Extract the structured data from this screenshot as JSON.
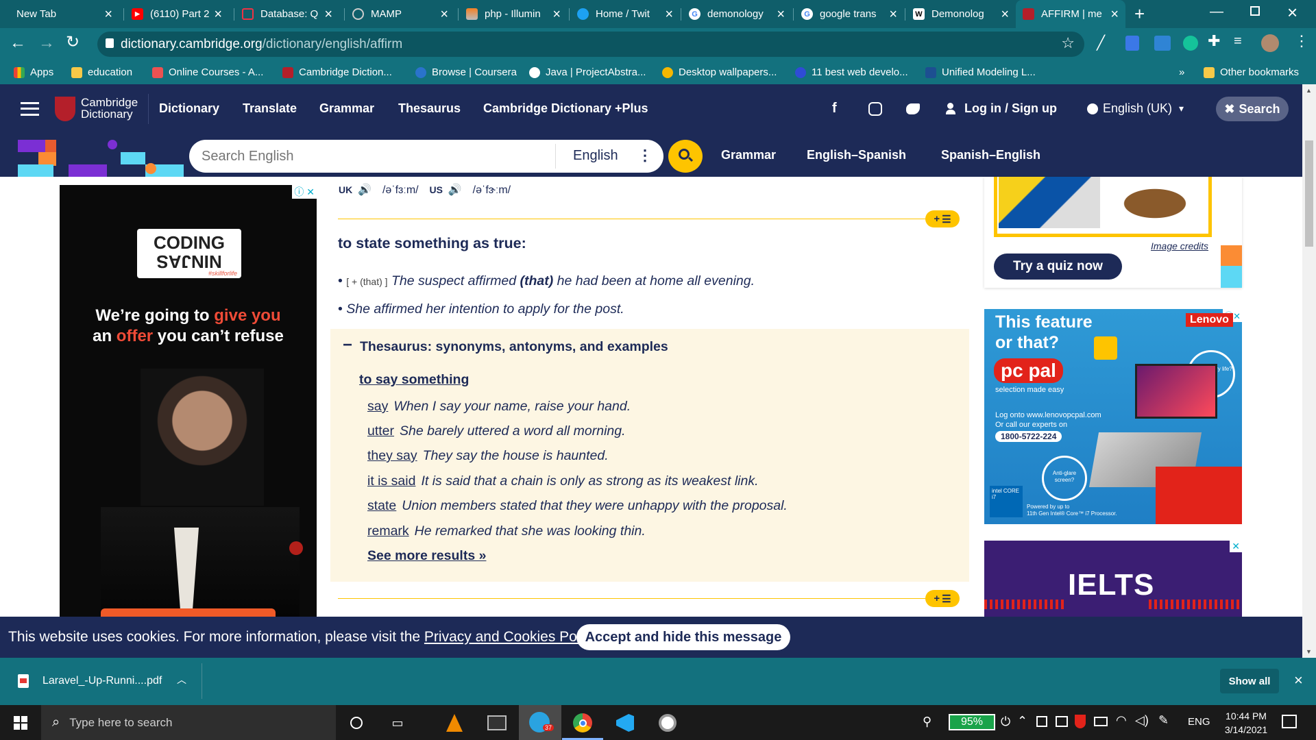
{
  "browser": {
    "tabs": [
      {
        "title": "New Tab",
        "favicon": "none"
      },
      {
        "title": "(6110) Part 2",
        "favicon": "youtube-icon"
      },
      {
        "title": "Database: Q",
        "favicon": "laravel-icon"
      },
      {
        "title": "MAMP",
        "favicon": "globe-icon"
      },
      {
        "title": "php - Illumin",
        "favicon": "stackoverflow-icon"
      },
      {
        "title": "Home / Twit",
        "favicon": "twitter-icon"
      },
      {
        "title": "demonology",
        "favicon": "google-icon"
      },
      {
        "title": "google trans",
        "favicon": "google-icon"
      },
      {
        "title": "Demonolog",
        "favicon": "wikipedia-icon"
      },
      {
        "title": "AFFIRM | me",
        "favicon": "cambridge-icon",
        "active": true
      }
    ],
    "new_tab_label": "+",
    "url_host": "dictionary.cambridge.org",
    "url_path": "/dictionary/english/affirm",
    "bookmarks": [
      {
        "label": "Apps",
        "icon": "apps-grid-icon"
      },
      {
        "label": "education",
        "icon": "folder-icon"
      },
      {
        "label": "Online Courses - A...",
        "icon": "udemy-icon"
      },
      {
        "label": "Cambridge Diction...",
        "icon": "cambridge-icon"
      },
      {
        "label": "Browse | Coursera",
        "icon": "coursera-icon"
      },
      {
        "label": "Java | ProjectAbstra...",
        "icon": "globe-icon"
      },
      {
        "label": "Desktop wallpapers...",
        "icon": "wallpaper-icon"
      },
      {
        "label": "11 best web develo...",
        "icon": "blog-icon"
      },
      {
        "label": "Unified Modeling L...",
        "icon": "uml-icon"
      }
    ],
    "bookmarks_overflow": "»",
    "other_bookmarks": "Other bookmarks"
  },
  "site": {
    "logo_line1": "Cambridge",
    "logo_line2": "Dictionary",
    "nav": [
      "Dictionary",
      "Translate",
      "Grammar",
      "Thesaurus",
      "Cambridge Dictionary +Plus"
    ],
    "login": "Log in / Sign up",
    "language": "English (UK)",
    "search_btn": "Search",
    "search_placeholder": "Search English",
    "search_lang": "English",
    "subnav": [
      "Grammar",
      "English–Spanish",
      "Spanish–English"
    ]
  },
  "entry": {
    "uk_label": "UK",
    "uk_ipa": "/əˈfɜːm/",
    "us_label": "US",
    "us_ipa": "/əˈfɝːm/",
    "definition": "to state something as true:",
    "examples": [
      {
        "gram": "[ + (that) ]",
        "pre": "The suspect affirmed ",
        "bold": "(that)",
        "post": " he had been at home all evening."
      },
      {
        "gram": "",
        "pre": "She affirmed her intention to apply for the post.",
        "bold": "",
        "post": ""
      }
    ],
    "thesaurus": {
      "toggle": "−",
      "title": "Thesaurus: synonyms, antonyms, and examples",
      "subtitle": "to say something",
      "items": [
        {
          "word": "say",
          "example": "When I say your name, raise your hand."
        },
        {
          "word": "utter",
          "example": "She barely uttered a word all morning."
        },
        {
          "word": "they say",
          "example": "They say the house is haunted."
        },
        {
          "word": "it is said",
          "example": "It is said that a chain is only as strong as its weakest link."
        },
        {
          "word": "state",
          "example": "Union members stated that they were unhappy with the proposal."
        },
        {
          "word": "remark",
          "example": "He remarked that she was looking thin."
        }
      ],
      "see_more": "See more results »"
    },
    "add_list": "+"
  },
  "ads": {
    "left_brand_top": "CODING",
    "left_brand_bottom": "NINJAS",
    "left_brand_tag": "#skillforlife",
    "left_line1_pre": "We’re going to ",
    "left_line1_hl": "give you",
    "left_line2_pre": "an ",
    "left_line2_hl": "offer",
    "left_line2_post": " you can’t refuse",
    "right1_title1": "This feature",
    "right1_title2": "or that?",
    "right1_brand": "pc pal",
    "right1_sub": "selection made easy",
    "right1_logo": "Lenovo",
    "right1_site": "Log onto www.lenovopcpal.com",
    "right1_call": "Or call our experts on",
    "right1_phone": "1800-5722-224",
    "right1_badge1": "Long battery life?",
    "right1_badge2": "Anti-glare screen?",
    "right1_powered": "Powered by up to",
    "right1_processor": "11th Gen Intel® Core™ i7 Processor.",
    "right1_chip": "intel CORE i7",
    "right2_text": "IELTS",
    "ad_close": "✕",
    "ad_info": "ⓘ"
  },
  "quiz": {
    "image_credits": "Image credits",
    "btn": "Try a quiz now"
  },
  "cookie": {
    "text": "This website uses cookies. For more information, please visit the ",
    "link": "Privacy and Cookies Policy",
    "period": ".",
    "accept": "Accept and hide this message"
  },
  "download": {
    "file": "Laravel_-Up-Runni....pdf",
    "show_all": "Show all"
  },
  "taskbar": {
    "search_placeholder": "Type here to search",
    "battery": "95%",
    "lang": "ENG",
    "time": "10:44 PM",
    "date": "3/14/2021",
    "telegram_badge": "37"
  }
}
